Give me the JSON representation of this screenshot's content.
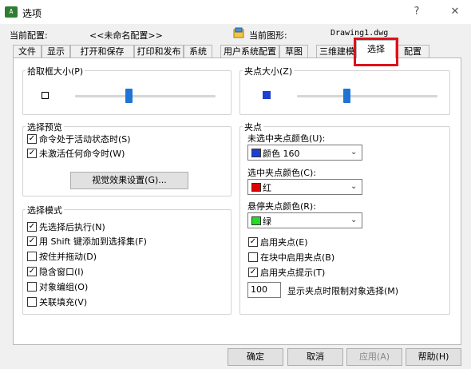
{
  "window": {
    "title": "选项",
    "help": "?",
    "close": "✕"
  },
  "header": {
    "current_config_label": "当前配置:",
    "current_config_value": "<<未命名配置>>",
    "current_drawing_label": "当前图形:",
    "current_drawing_value": "Drawing1.dwg"
  },
  "tabs": [
    {
      "label": "文件"
    },
    {
      "label": "显示"
    },
    {
      "label": "打开和保存"
    },
    {
      "label": "打印和发布"
    },
    {
      "label": "系统"
    },
    {
      "label": "用户系统配置"
    },
    {
      "label": "草图"
    },
    {
      "label": "三维建模"
    },
    {
      "label": "选择",
      "active": true
    },
    {
      "label": "配置"
    }
  ],
  "pickbox": {
    "title": "拾取框大小(P)",
    "level": 0.38
  },
  "grip_size": {
    "title": "夹点大小(Z)",
    "level": 0.35
  },
  "selection_preview": {
    "title": "选择预览",
    "options": [
      {
        "label": "命令处于活动状态时(S)",
        "checked": true
      },
      {
        "label": "未激活任何命令时(W)",
        "checked": true
      }
    ],
    "visual_effects_button": "视觉效果设置(G)..."
  },
  "selection_mode": {
    "title": "选择模式",
    "options": [
      {
        "label": "先选择后执行(N)",
        "checked": true
      },
      {
        "label": "用 Shift 键添加到选择集(F)",
        "checked": true
      },
      {
        "label": "按住并拖动(D)",
        "checked": false
      },
      {
        "label": "隐含窗口(I)",
        "checked": true
      },
      {
        "label": "对象编组(O)",
        "checked": false
      },
      {
        "label": "关联填充(V)",
        "checked": false
      }
    ]
  },
  "grips": {
    "title": "夹点",
    "unselected_color_label": "未选中夹点颜色(U):",
    "unselected_color_value": "颜色 160",
    "unselected_color_hex": "#1f3fd0",
    "selected_color_label": "选中夹点颜色(C):",
    "selected_color_value": "红",
    "selected_color_hex": "#e00000",
    "hover_color_label": "悬停夹点颜色(R):",
    "hover_color_value": "绿",
    "hover_color_hex": "#22dd22",
    "options": [
      {
        "label": "启用夹点(E)",
        "checked": true
      },
      {
        "label": "在块中启用夹点(B)",
        "checked": false
      },
      {
        "label": "启用夹点提示(T)",
        "checked": true
      }
    ],
    "limit_value": "100",
    "limit_label": "显示夹点时限制对象选择(M)"
  },
  "buttons": {
    "ok": "确定",
    "cancel": "取消",
    "apply": "应用(A)",
    "help": "帮助(H)"
  },
  "colors": {
    "accent": "#1f74d6",
    "highlight": "#e0101a"
  }
}
